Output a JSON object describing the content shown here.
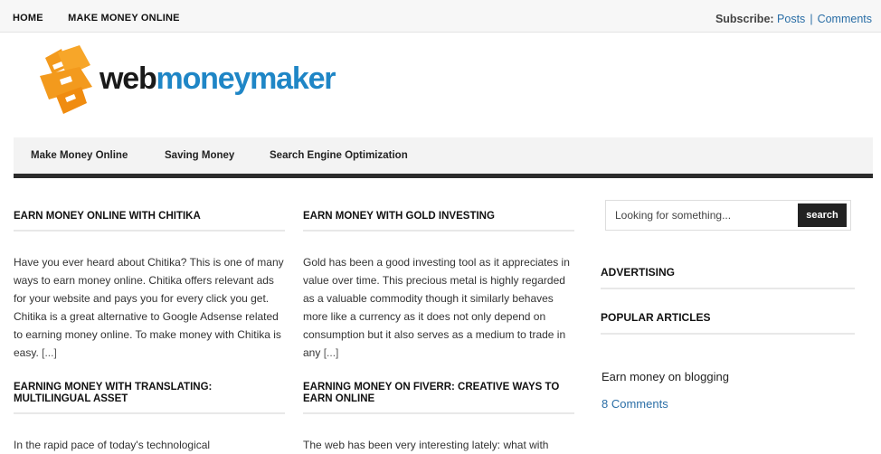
{
  "topbar": {
    "nav": [
      "HOME",
      "MAKE MONEY ONLINE"
    ],
    "subscribe_label": "Subscribe:",
    "posts_link": "Posts",
    "separator": "|",
    "comments_link": "Comments"
  },
  "logo": {
    "web": "web",
    "moneymaker": "moneymaker",
    "icon": "orange-chevron-logo-icon",
    "colors": {
      "orange": "#f39a1d",
      "blue": "#1f86c6",
      "dark": "#1a1a1a"
    }
  },
  "mainnav": [
    "Make Money Online",
    "Saving Money",
    "Search Engine Optimization"
  ],
  "posts": [
    {
      "title": "EARN MONEY ONLINE WITH CHITIKA",
      "excerpt": "Have you ever heard about Chitika? This is one of many ways to earn money online. Chitika offers relevant ads for your website and pays you for every click you get. Chitika is a great alternative to Google Adsense related to earning money online. To make money with Chitika is easy.",
      "more": "[...]"
    },
    {
      "title": "EARN MONEY WITH GOLD INVESTING",
      "excerpt": "Gold has been a good investing tool as it appreciates in value over time. This precious metal is highly regarded as a valuable commodity though it similarly behaves more like a currency as it does not only depend on consumption but it also serves as a medium to trade in any",
      "more": "[...]"
    },
    {
      "title": "EARNING MONEY WITH TRANSLATING: MULTILINGUAL ASSET",
      "excerpt": "In the rapid pace of today's technological",
      "more": ""
    },
    {
      "title": "EARNING MONEY ON FIVERR: CREATIVE WAYS TO EARN ONLINE",
      "excerpt": "The web has been very interesting lately: what with",
      "more": ""
    }
  ],
  "sidebar": {
    "search_placeholder": "Looking for something...",
    "search_button": "search",
    "advertising_title": "ADVERTISING",
    "popular_title": "POPULAR ARTICLES",
    "popular_item": "Earn money on blogging",
    "popular_comments": "8 Comments"
  }
}
